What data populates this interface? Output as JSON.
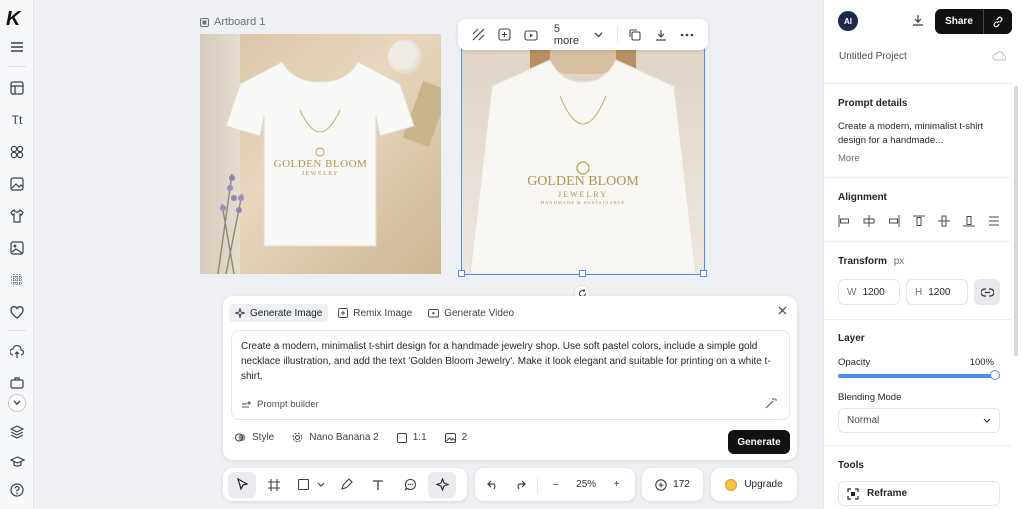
{
  "app": {
    "logo_letter": "K"
  },
  "canvas": {
    "artboard_label": "Artboard 1",
    "design_brand": "GOLDEN BLOOM",
    "design_sub": "JEWELRY",
    "design_tag": "HANDMADE & SUSTAINABLE"
  },
  "floating_toolbar": {
    "more_label": "5 more"
  },
  "generate": {
    "tabs": [
      {
        "label": "Generate Image",
        "active": true
      },
      {
        "label": "Remix Image",
        "active": false
      },
      {
        "label": "Generate Video",
        "active": false
      }
    ],
    "prompt": "Create a modern, minimalist t-shirt design for a handmade jewelry shop. Use soft pastel colors, include a simple gold necklace illustration, and add the text 'Golden Bloom Jewelry'. Make it look elegant and suitable for printing on a white t-shirt.",
    "prompt_builder_label": "Prompt builder",
    "style_label": "Style",
    "model_label": "Nano Banana 2",
    "ratio_label": "1:1",
    "count_label": "2",
    "generate_button": "Generate"
  },
  "bottom_toolbar": {
    "zoom_minus": "–",
    "zoom_value": "25%",
    "zoom_plus": "+",
    "credits": "172",
    "upgrade_label": "Upgrade"
  },
  "right_panel": {
    "avatar_text": "AI",
    "share_label": "Share",
    "project_name": "Untitled Project",
    "prompt_details": {
      "title": "Prompt details",
      "excerpt": "Create a modern, minimalist t-shirt design for a handmade...",
      "more_label": "More"
    },
    "alignment_title": "Alignment",
    "transform": {
      "title": "Transform",
      "unit": "px",
      "w_label": "W",
      "w_value": "1200",
      "h_label": "H",
      "h_value": "1200"
    },
    "layer": {
      "title": "Layer",
      "opacity_label": "Opacity",
      "opacity_value": "100%",
      "opacity_fraction": 1.0,
      "blending_label": "Blending Mode",
      "blending_value": "Normal"
    },
    "tools": {
      "title": "Tools",
      "reframe_label": "Reframe"
    }
  },
  "colors": {
    "accent": "#4f8df5",
    "primary_button": "#111111",
    "gold": "#b19452"
  }
}
